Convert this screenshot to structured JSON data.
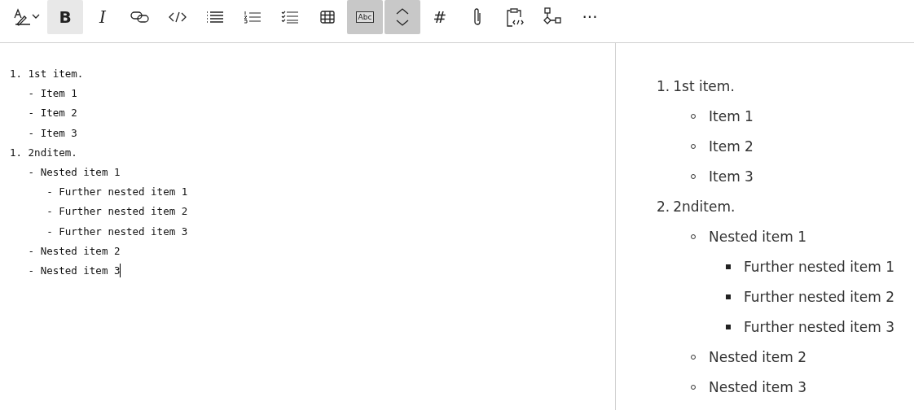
{
  "toolbar": {
    "buttons": [
      {
        "kind": "format",
        "pressed": false,
        "hovered": false
      },
      {
        "kind": "bold",
        "label": "B",
        "pressed": false,
        "hovered": true
      },
      {
        "kind": "italic",
        "label": "I",
        "pressed": false,
        "hovered": false
      },
      {
        "kind": "link",
        "pressed": false,
        "hovered": false
      },
      {
        "kind": "code",
        "pressed": false,
        "hovered": false
      },
      {
        "kind": "bullets",
        "pressed": false,
        "hovered": false
      },
      {
        "kind": "numbers",
        "pressed": false,
        "hovered": false
      },
      {
        "kind": "tasks",
        "pressed": false,
        "hovered": false
      },
      {
        "kind": "table",
        "pressed": false,
        "hovered": false
      },
      {
        "kind": "abc",
        "label": "Abc",
        "pressed": true,
        "hovered": false
      },
      {
        "kind": "toggle",
        "pressed": true,
        "hovered": false
      },
      {
        "kind": "heading",
        "label": "#",
        "pressed": false,
        "hovered": false
      },
      {
        "kind": "attach",
        "pressed": false,
        "hovered": false
      },
      {
        "kind": "snippet",
        "pressed": false,
        "hovered": false
      },
      {
        "kind": "diagram",
        "pressed": false,
        "hovered": false
      },
      {
        "kind": "more",
        "label": "···",
        "pressed": false,
        "hovered": false
      }
    ]
  },
  "editor": {
    "lines": [
      {
        "text": "1. 1st item.",
        "cursor": false
      },
      {
        "text": "   - Item 1",
        "cursor": false
      },
      {
        "text": "   - Item 2",
        "cursor": false
      },
      {
        "text": "   - Item 3",
        "cursor": false
      },
      {
        "text": "1. 2nditem.",
        "cursor": false
      },
      {
        "text": "   - Nested item 1",
        "cursor": false
      },
      {
        "text": "      - Further nested item 1",
        "cursor": false
      },
      {
        "text": "      - Further nested item 2",
        "cursor": false
      },
      {
        "text": "      - Further nested item 3",
        "cursor": false
      },
      {
        "text": "   - Nested item 2",
        "cursor": false
      },
      {
        "text": "   - Nested item 3",
        "cursor": true
      }
    ]
  },
  "preview": {
    "items": [
      {
        "marker": "1.",
        "text": "1st item.",
        "children": [
          {
            "text": "Item 1"
          },
          {
            "text": "Item 2"
          },
          {
            "text": "Item 3"
          }
        ]
      },
      {
        "marker": "2.",
        "text": "2nditem.",
        "children": [
          {
            "text": "Nested item 1",
            "children": [
              {
                "text": "Further nested item 1"
              },
              {
                "text": "Further nested item 2"
              },
              {
                "text": "Further nested item 3"
              }
            ]
          },
          {
            "text": "Nested item 2"
          },
          {
            "text": "Nested item 3"
          }
        ]
      }
    ]
  }
}
